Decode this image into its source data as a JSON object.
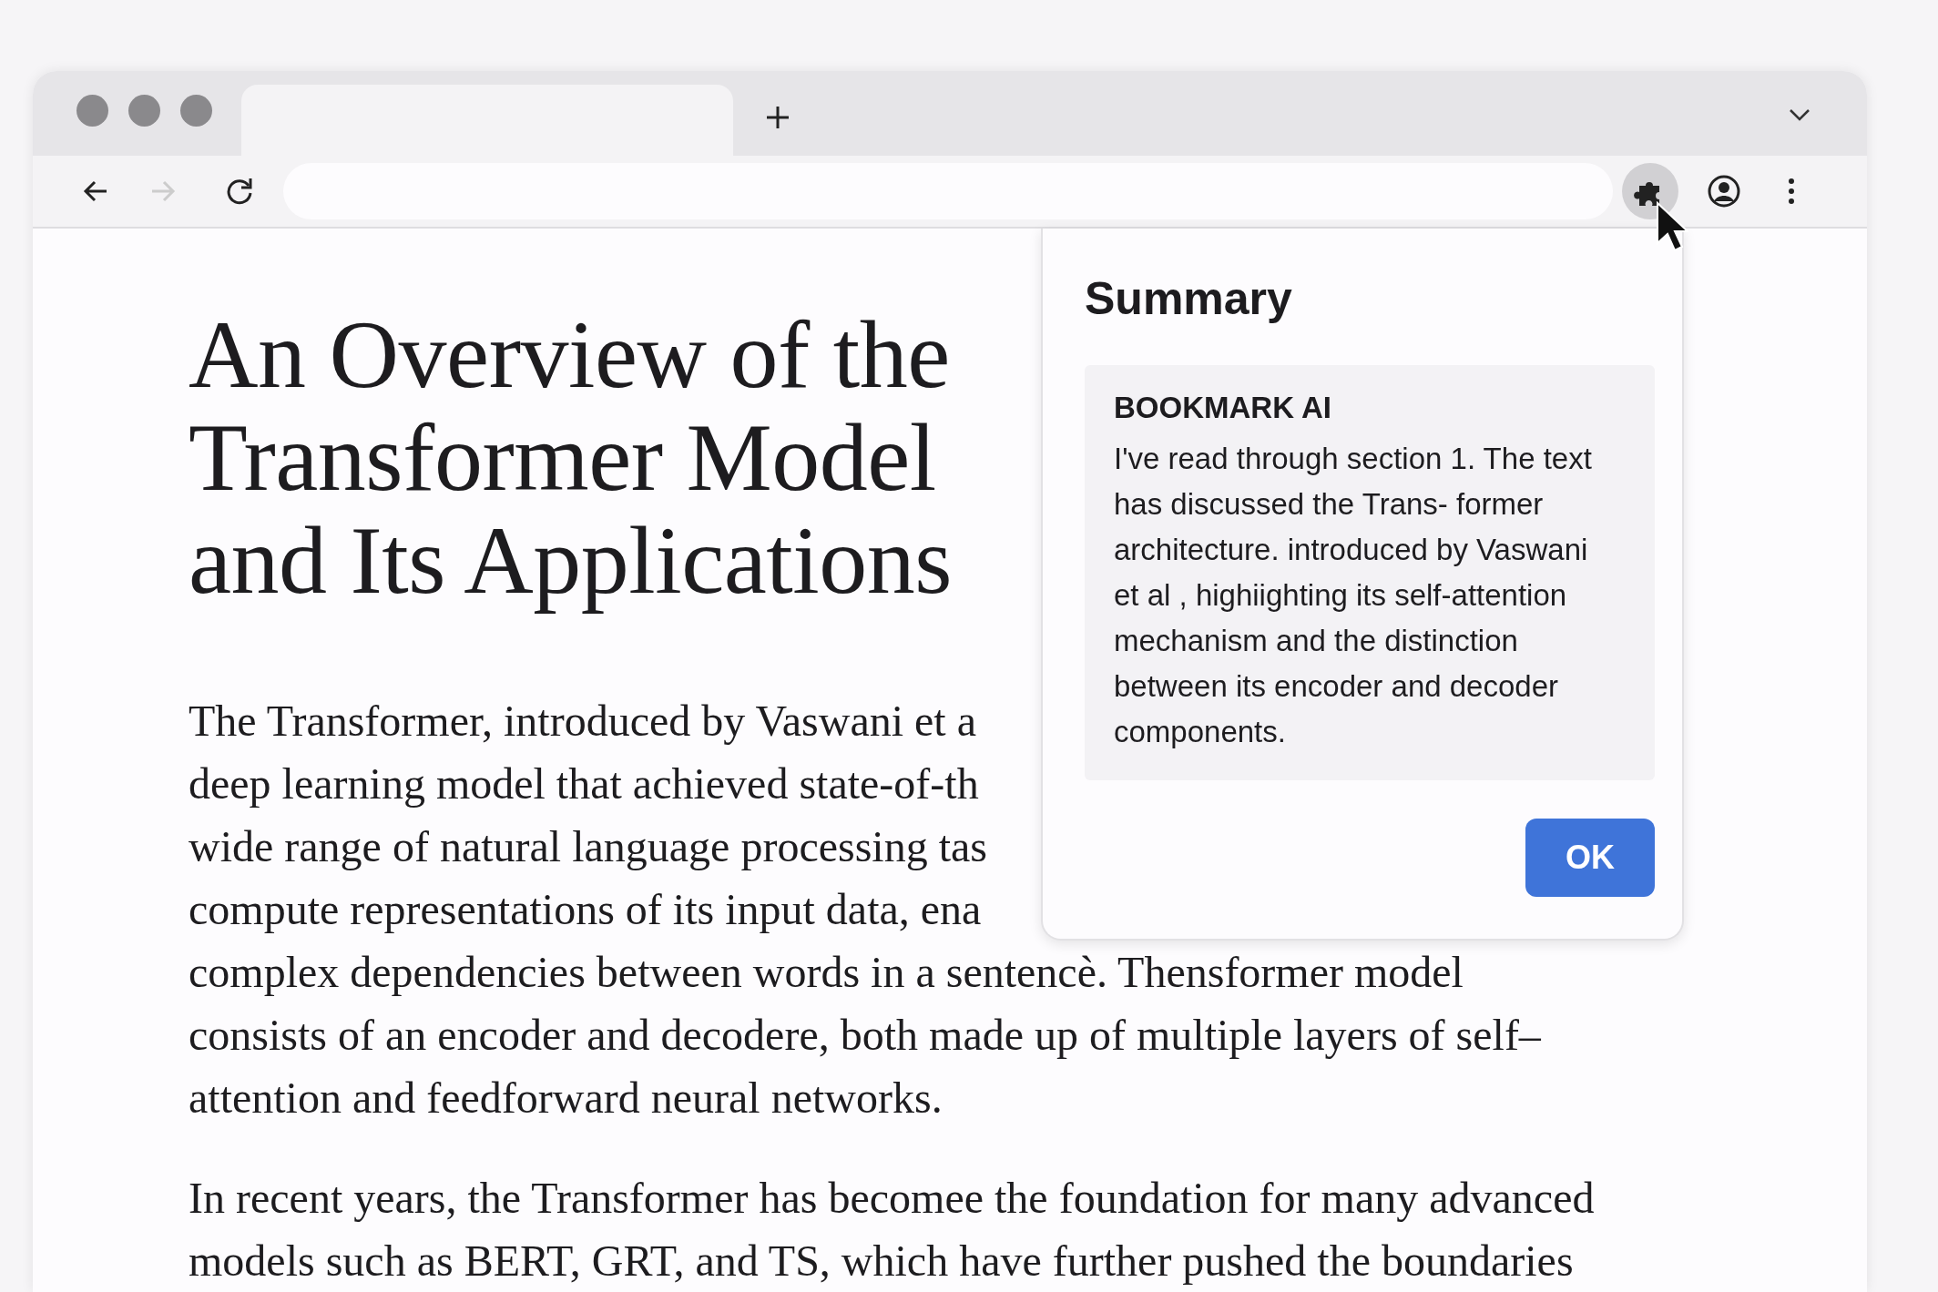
{
  "article": {
    "title_lines": [
      "An Overview of the",
      "Transformer Model",
      "and Its Applications"
    ],
    "paragraphs": [
      {
        "lines": [
          "The Transformer, introduced by Vaswani et a",
          "deep learning model that achieved state-of-th",
          "wide range of natural language processing tas",
          "compute representations of its input data, ena",
          "complex dependencies between words in a sentencè.  Thensformer model",
          "consists of an encoder and decodere, both made up of multiple layers of self–",
          "attention and feedforward neural networks."
        ]
      },
      {
        "lines": [
          "In recent years, the Transformer has becomee the foundation for many advanced",
          "models such as BERT, GRT, and TS, which have further pushed the boundaries"
        ]
      }
    ]
  },
  "popup": {
    "title": "Summary",
    "source": "BOOKMARK AI",
    "text": "I've read through section 1. The text has discussed the Trans- former architecture. introduced by Vaswani et al , highiighting its self-attention mechanism and the distinction between its encoder and decoder components.",
    "button": "OK"
  }
}
